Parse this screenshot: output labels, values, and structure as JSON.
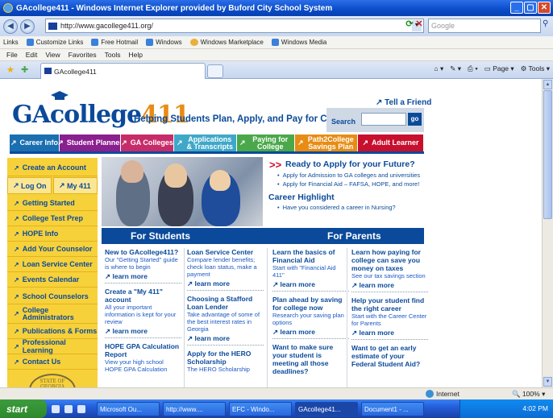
{
  "window": {
    "title": "GAcollege411 - Windows Internet Explorer provided by Buford City School System",
    "min": "_",
    "max": "▢",
    "close": "✕"
  },
  "address": {
    "url": "http://www.gacollege411.org/",
    "search_placeholder": "Google"
  },
  "links_bar": [
    "Links",
    "Customize Links",
    "Free Hotmail",
    "Windows",
    "Windows Marketplace",
    "Windows Media"
  ],
  "menu": [
    "File",
    "Edit",
    "View",
    "Favorites",
    "Tools",
    "Help"
  ],
  "tab": {
    "title": "GAcollege411"
  },
  "toolbar": {
    "page": "Page",
    "tools": "Tools"
  },
  "site": {
    "logo_ga": "GA",
    "logo_college": "college",
    "logo_411": "411",
    "tagline": "Helping Students Plan, Apply, and Pay for College",
    "tell_friend": "Tell a Friend",
    "search_label": "Search",
    "search_go": "go"
  },
  "nav": [
    {
      "label": "Career Info",
      "color": "#1a6fb0"
    },
    {
      "label": "Student Planner",
      "color": "#8a1f8f"
    },
    {
      "label": "GA Colleges",
      "color": "#c72c6a"
    },
    {
      "label": "Applications & Transcripts",
      "color": "#3fa8c8"
    },
    {
      "label": "Paying for College",
      "color": "#4aa84a"
    },
    {
      "label": "Path2College Savings Plan",
      "color": "#e88c14"
    },
    {
      "label": "Adult Learner",
      "color": "#c8102e"
    }
  ],
  "sidebar": {
    "create": "Create an Account",
    "login": "Log On",
    "my411": "My 411",
    "items": [
      "Getting Started",
      "College Test Prep",
      "HOPE Info",
      "Add Your Counselor",
      "Loan Service Center",
      "Events Calendar",
      "School Counselors",
      "College Administrators",
      "Publications & Forms",
      "Professional Learning",
      "Contact Us"
    ],
    "seal": "STATE OF GEORGIA"
  },
  "hero": {
    "title": "Ready to Apply for your Future?",
    "bullet1": "Apply for Admission to GA colleges and universities",
    "bullet2": "Apply for Financial Aid – FAFSA, HOPE, and more!",
    "career_heading": "Career Highlight",
    "career_bullet": "Have you considered a career in Nursing?"
  },
  "band": {
    "students": "For Students",
    "parents": "For Parents"
  },
  "learn_more": "learn more",
  "columns": {
    "c1": [
      {
        "h": "New to GAcollege411?",
        "b": "Our \"Getting Started\" guide is where to begin"
      },
      {
        "h": "Create a \"My 411\" account",
        "b": "All your important information is kept for your review"
      },
      {
        "h": "HOPE GPA Calculation Report",
        "b": "View your high school HOPE GPA Calculation"
      }
    ],
    "c2": [
      {
        "h": "Loan Service Center",
        "b": "Compare lender benefits; check loan status, make a payment"
      },
      {
        "h": "Choosing a Stafford Loan Lender",
        "b": "Take advantage of some of the best interest rates in Georgia"
      },
      {
        "h": "Apply for the HERO Scholarship",
        "b": "The HERO Scholarship"
      }
    ],
    "c3": [
      {
        "h": "Learn the basics of Financial Aid",
        "b": "Start with \"Financial Aid 411\""
      },
      {
        "h": "Plan ahead by saving for college now",
        "b": "Research your saving plan options"
      },
      {
        "h": "Want to make sure your student is meeting all those deadlines?",
        "b": ""
      }
    ],
    "c4": [
      {
        "h": "Learn how paying for college can save you money on taxes",
        "b": "See our tax savings section"
      },
      {
        "h": "Help your student find the right career",
        "b": "Start with the Career Center for Parents"
      },
      {
        "h": "Want to get an early estimate of your Federal Student Aid?",
        "b": ""
      }
    ]
  },
  "status": {
    "zone": "Internet",
    "zoom": "100%"
  },
  "taskbar": {
    "start": "start",
    "tasks": [
      "Microsoft Ou...",
      "http://www....",
      "EFC - Windo...",
      "GAcollege41...",
      "Document1 - ..."
    ],
    "clock": "4:02 PM"
  }
}
